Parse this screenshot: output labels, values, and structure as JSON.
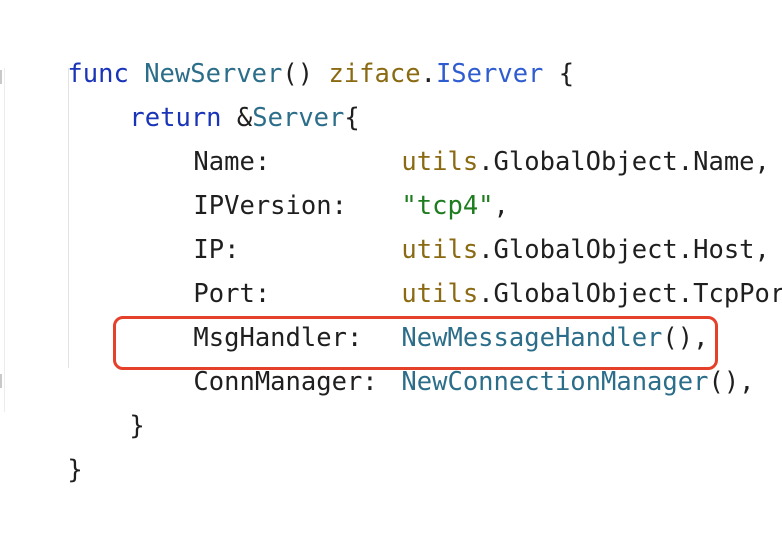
{
  "code": {
    "line1": {
      "kw_func": "func",
      "fn_name": "NewServer",
      "parens": "()",
      "pkg": "ziface",
      "dot": ".",
      "iface": "IServer",
      "brace": "{"
    },
    "line2": {
      "kw_return": "return",
      "amp": "&",
      "type": "Server",
      "brace": "{"
    },
    "fields": [
      {
        "name": "Name:",
        "pkg": "utils",
        "rest": ".GlobalObject.Name,"
      },
      {
        "name": "IPVersion:",
        "str": "\"tcp4\"",
        "rest": ","
      },
      {
        "name": "IP:",
        "pkg": "utils",
        "rest": ".GlobalObject.Host,"
      },
      {
        "name": "Port:",
        "pkg": "utils",
        "rest": ".GlobalObject.TcpPort,"
      },
      {
        "name": "MsgHandler:",
        "call": "NewMessageHandler",
        "rest": "(),"
      },
      {
        "name": "ConnManager:",
        "call": "NewConnectionManager",
        "rest": "(),"
      }
    ],
    "close_inner": "}",
    "close_outer": "}"
  },
  "colors": {
    "keyword": "#1a34b8",
    "function": "#2c6e8a",
    "package": "#8a6a12",
    "string": "#1e7d1e",
    "interface": "#2f5dd0",
    "highlight_border": "#e5402a"
  }
}
